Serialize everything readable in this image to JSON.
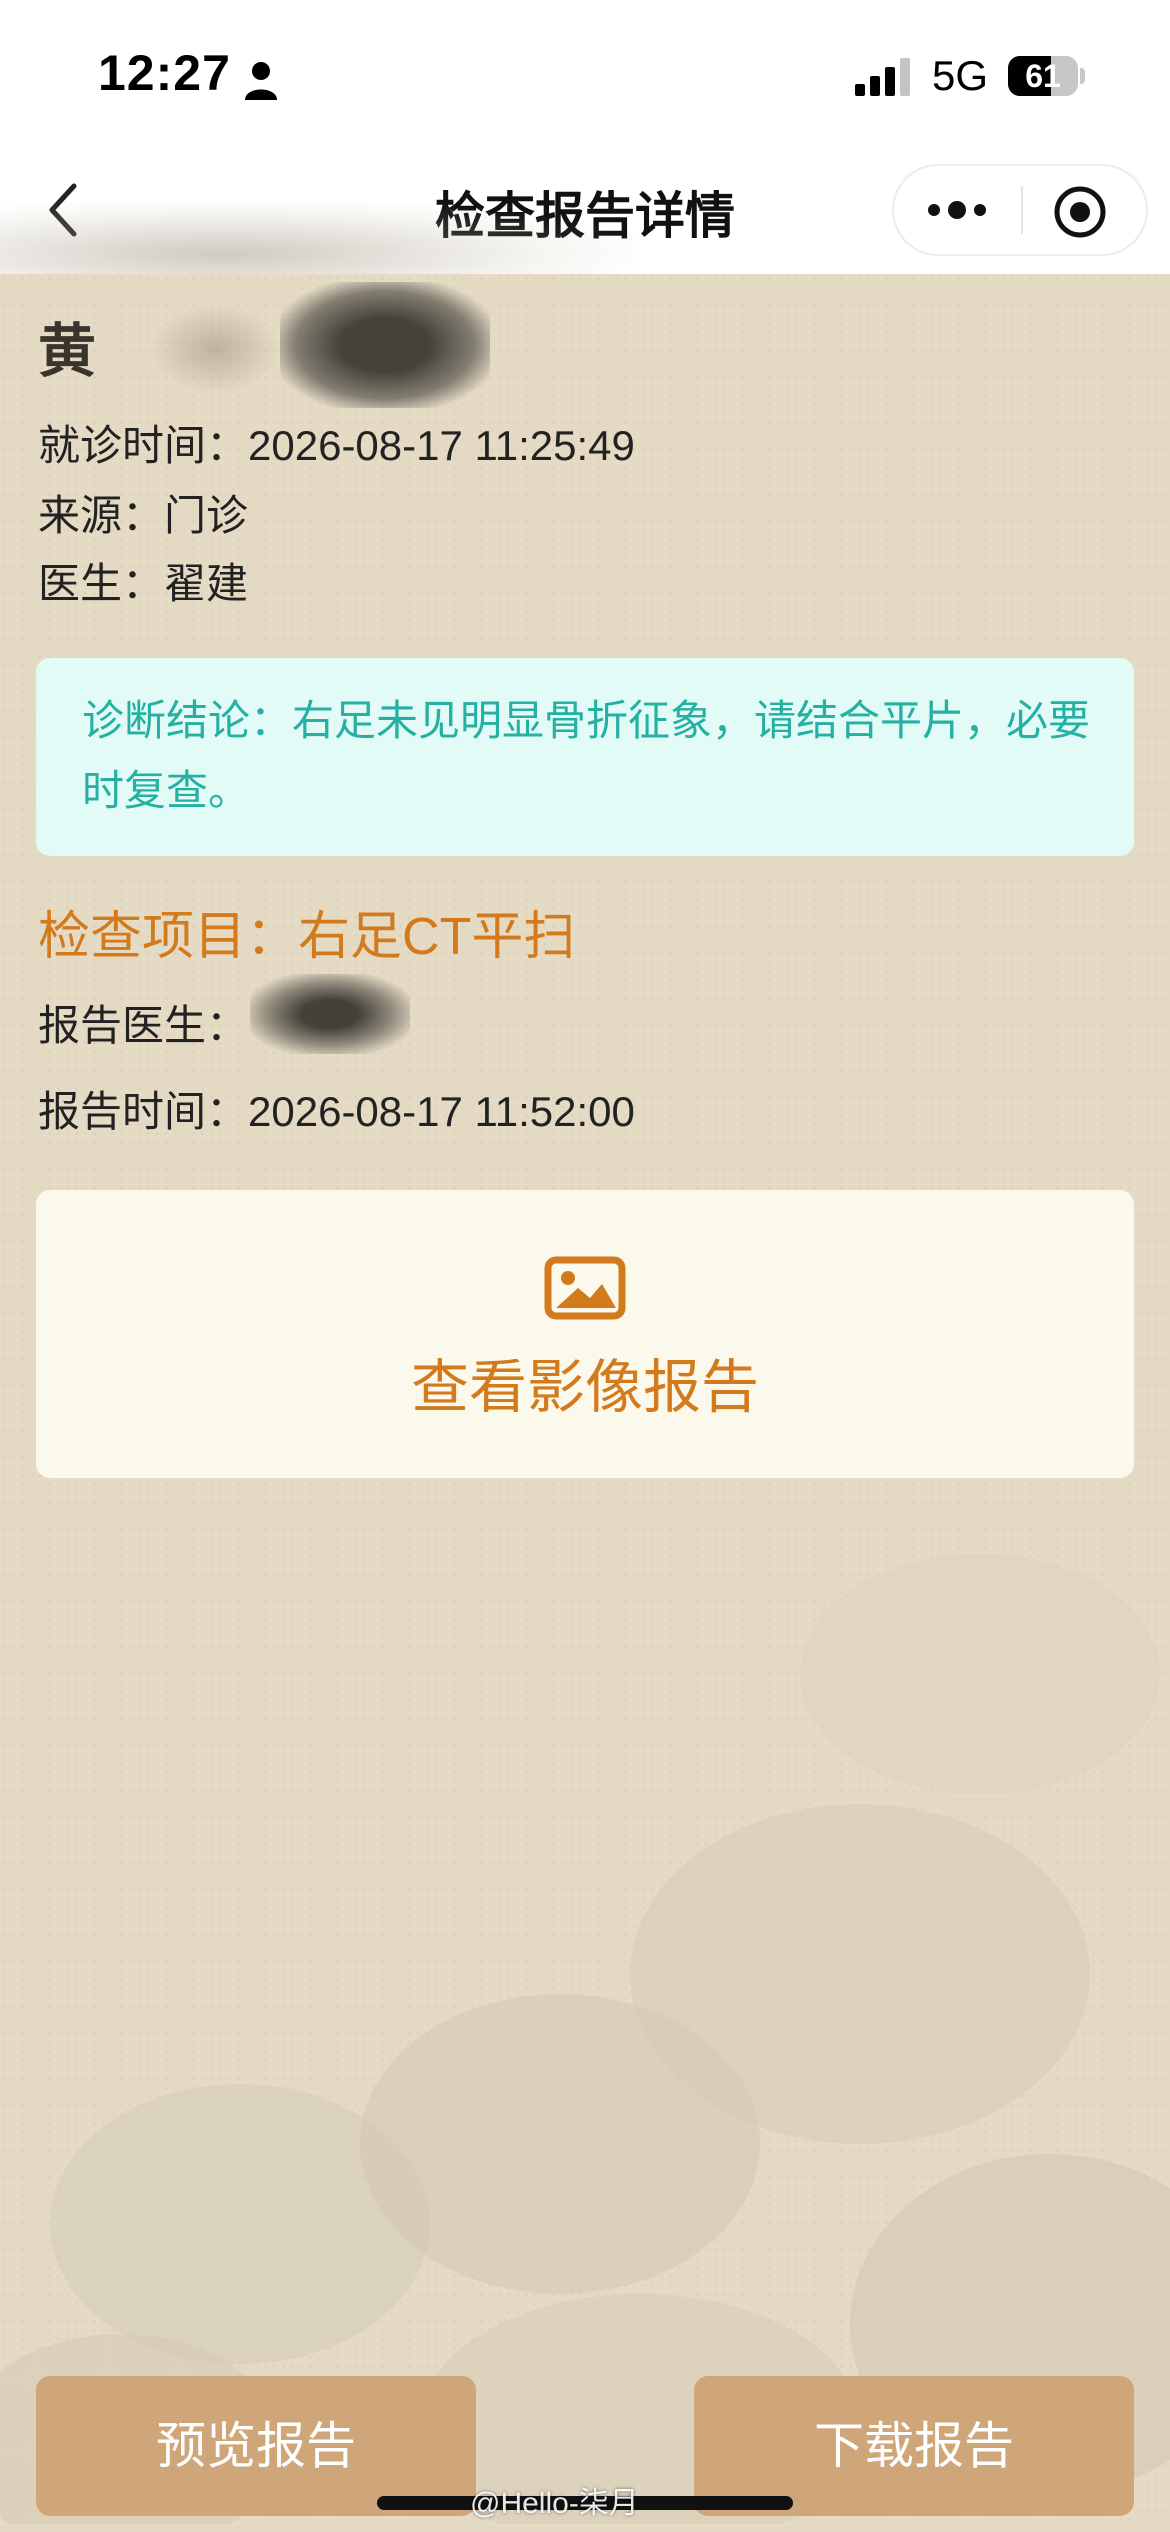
{
  "status_bar": {
    "time": "12:27",
    "network": "5G",
    "battery": "61",
    "battery_level": 0.61
  },
  "nav": {
    "title": "检查报告详情"
  },
  "patient": {
    "name": "黄"
  },
  "visit": {
    "time_label": "就诊时间：",
    "time_value": "2026-08-17 11:25:49",
    "source_label": "来源：",
    "source_value": "门诊",
    "doctor_label": "医生：",
    "doctor_value": "翟建"
  },
  "diagnosis": {
    "text": "诊断结论：右足未见明显骨折征象，请结合平片，必要时复查。"
  },
  "exam": {
    "item_label": "检查项目：",
    "item_value": "右足CT平扫",
    "report_doctor_label": "报告医生：",
    "report_time_label": "报告时间：",
    "report_time_value": "2026-08-17 11:52:00"
  },
  "image_report": {
    "label": "查看影像报告"
  },
  "actions": {
    "preview": "预览报告",
    "download": "下载报告"
  },
  "watermark": {
    "text": "@Hello-柒月"
  },
  "colors": {
    "accent_orange": "#d27a1c",
    "diagnosis_text": "#25b0a4",
    "diagnosis_bg": "#e3fbf7",
    "button_bg": "#cfa679",
    "page_bg": "#e5dbc5"
  }
}
